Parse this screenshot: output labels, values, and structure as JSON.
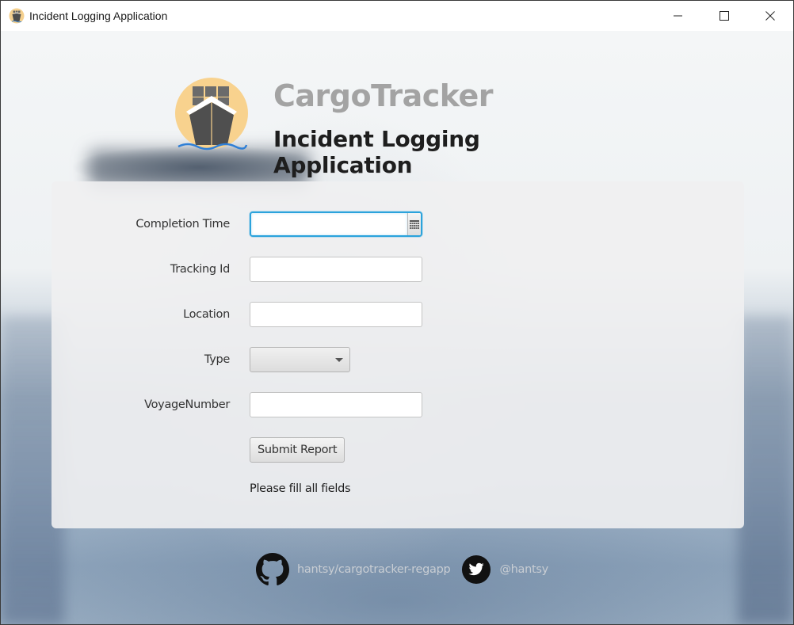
{
  "window": {
    "title": "Incident Logging Application",
    "controls": [
      "minimize",
      "maximize",
      "close"
    ]
  },
  "header": {
    "brand": "CargoTracker",
    "subtitle": "Incident Logging Application",
    "logo_icon": "cargo-ship-logo-icon"
  },
  "form": {
    "fields": [
      {
        "label": "Completion Time",
        "type": "date-picker",
        "value": "",
        "icon": "calendar-icon"
      },
      {
        "label": "Tracking Id",
        "type": "text",
        "value": ""
      },
      {
        "label": "Location",
        "type": "text",
        "value": ""
      },
      {
        "label": "Type",
        "type": "combo",
        "value": ""
      },
      {
        "label": "VoyageNumber",
        "type": "text",
        "value": ""
      }
    ],
    "submit_label": "Submit Report",
    "status_message": "Please fill all fields"
  },
  "footer": {
    "github_icon": "github-icon",
    "github_text": "hantsy/cargotracker-regapp",
    "twitter_icon": "twitter-icon",
    "twitter_text": "@hantsy"
  },
  "colors": {
    "focus_accent": "#2ba3dc",
    "brand_text": "#a3a3a3",
    "logo_background": "#f8d28e",
    "logo_wave": "#2f7fd6"
  }
}
